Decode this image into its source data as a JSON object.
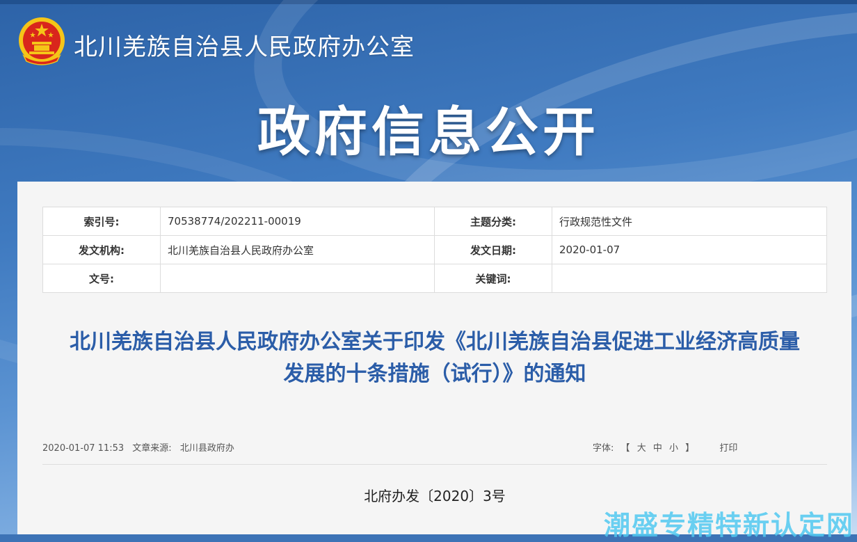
{
  "header": {
    "site_title": "北川羌族自治县人民政府办公室",
    "banner_title": "政府信息公开"
  },
  "meta_table": {
    "index_label": "索引号:",
    "index_value": "70538774/202211-00019",
    "category_label": "主题分类:",
    "category_value": "行政规范性文件",
    "issuer_label": "发文机构:",
    "issuer_value": "北川羌族自治县人民政府办公室",
    "date_label": "发文日期:",
    "date_value": "2020-01-07",
    "docno_label": "文号:",
    "docno_value": "",
    "keywords_label": "关键词:",
    "keywords_value": ""
  },
  "document": {
    "title_line1": "北川羌族自治县人民政府办公室关于印发《北川羌族自治县促进工业经济高质量",
    "title_line2": "发展的十条措施（试行）》的通知",
    "publish_time": "2020-01-07 11:53",
    "source_label": "文章来源:",
    "source_value": "北川县政府办",
    "font_label": "字体:",
    "font_bracket_open": "【",
    "font_large": "大",
    "font_medium": "中",
    "font_small": "小",
    "font_bracket_close": "】",
    "print_label": "打印",
    "doc_number": "北府办发〔2020〕3号"
  },
  "watermark": "潮盛专精特新认定网",
  "colors": {
    "banner_blue": "#3d73b6",
    "title_blue": "#2b5da8",
    "emblem_red": "#d9261c",
    "emblem_gold": "#f5c518"
  }
}
